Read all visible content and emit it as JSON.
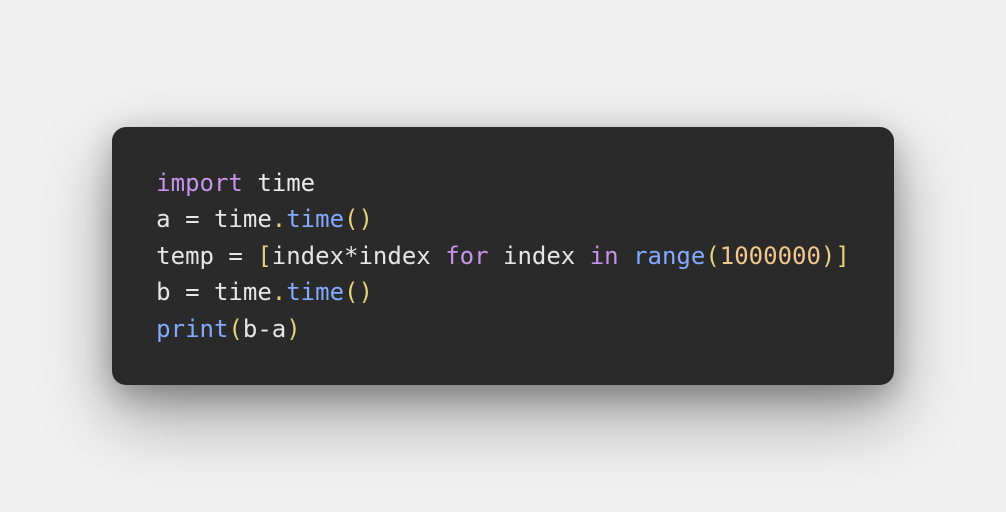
{
  "code": {
    "lines": [
      {
        "tokens": [
          {
            "cls": "tok-kw",
            "t": "import"
          },
          {
            "cls": "tok-plain",
            "t": " "
          },
          {
            "cls": "tok-cls",
            "t": "time"
          }
        ]
      },
      {
        "tokens": [
          {
            "cls": "tok-plain",
            "t": "a "
          },
          {
            "cls": "tok-op",
            "t": "="
          },
          {
            "cls": "tok-plain",
            "t": " time"
          },
          {
            "cls": "tok-punc",
            "t": "."
          },
          {
            "cls": "tok-func",
            "t": "time"
          },
          {
            "cls": "tok-punc",
            "t": "()"
          }
        ]
      },
      {
        "tokens": [
          {
            "cls": "tok-plain",
            "t": "temp "
          },
          {
            "cls": "tok-op",
            "t": "="
          },
          {
            "cls": "tok-plain",
            "t": " "
          },
          {
            "cls": "tok-punc",
            "t": "["
          },
          {
            "cls": "tok-plain",
            "t": "index"
          },
          {
            "cls": "tok-op",
            "t": "*"
          },
          {
            "cls": "tok-plain",
            "t": "index "
          },
          {
            "cls": "tok-kw",
            "t": "for"
          },
          {
            "cls": "tok-plain",
            "t": " index "
          },
          {
            "cls": "tok-kw",
            "t": "in"
          },
          {
            "cls": "tok-plain",
            "t": " "
          },
          {
            "cls": "tok-func",
            "t": "range"
          },
          {
            "cls": "tok-punc",
            "t": "("
          },
          {
            "cls": "tok-num",
            "t": "1000000"
          },
          {
            "cls": "tok-punc",
            "t": ")]"
          }
        ]
      },
      {
        "tokens": [
          {
            "cls": "tok-plain",
            "t": "b "
          },
          {
            "cls": "tok-op",
            "t": "="
          },
          {
            "cls": "tok-plain",
            "t": " time"
          },
          {
            "cls": "tok-punc",
            "t": "."
          },
          {
            "cls": "tok-func",
            "t": "time"
          },
          {
            "cls": "tok-punc",
            "t": "()"
          }
        ]
      },
      {
        "tokens": [
          {
            "cls": "tok-func",
            "t": "print"
          },
          {
            "cls": "tok-punc",
            "t": "("
          },
          {
            "cls": "tok-plain",
            "t": "b"
          },
          {
            "cls": "tok-op",
            "t": "-"
          },
          {
            "cls": "tok-plain",
            "t": "a"
          },
          {
            "cls": "tok-punc",
            "t": ")"
          }
        ]
      }
    ]
  }
}
